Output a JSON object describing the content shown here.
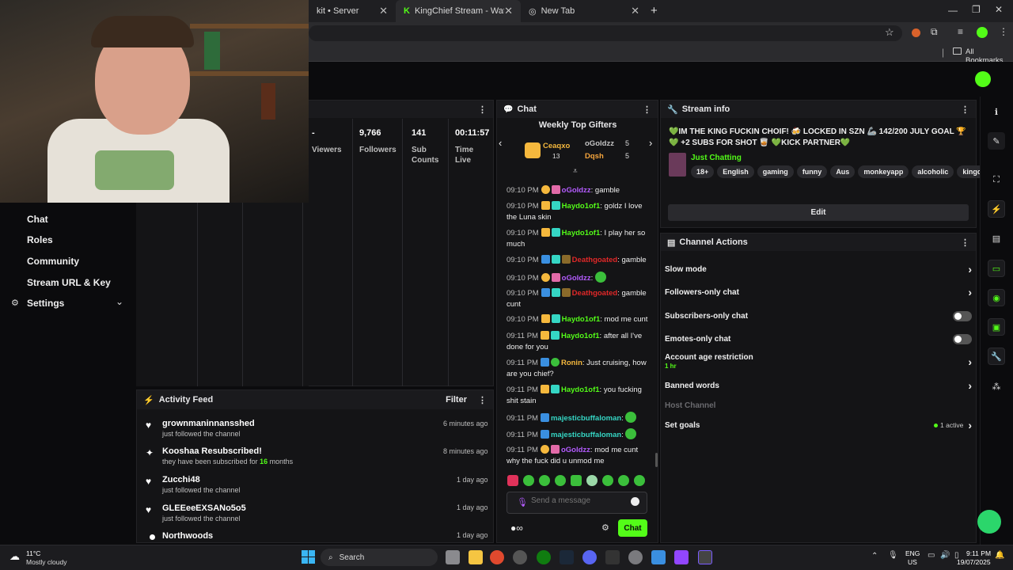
{
  "browser": {
    "tabs": [
      {
        "label": "kit • Server"
      },
      {
        "label": "KingChief Stream - Watch Live o"
      },
      {
        "label": "New Tab"
      }
    ],
    "new_tab": "+",
    "bookmarks_label": "All Bookmarks"
  },
  "nav": {
    "items": [
      {
        "label": "Chat"
      },
      {
        "label": "Roles"
      },
      {
        "label": "Community"
      },
      {
        "label": "Stream URL & Key"
      },
      {
        "label": "Settings"
      }
    ]
  },
  "stats": {
    "items": [
      {
        "value": "-",
        "label": "Viewers"
      },
      {
        "value": "9,766",
        "label": "Followers"
      },
      {
        "value": "141",
        "label": "Sub Counts"
      },
      {
        "value": "00:11:57",
        "label": "Time Live"
      }
    ]
  },
  "activity": {
    "title": "Activity Feed",
    "filter": "Filter",
    "items": [
      {
        "name": "grownmaninnansshed",
        "sub": "just followed the channel",
        "time": "6 minutes ago",
        "icon": "heart-icon"
      },
      {
        "name": "Kooshaa Resubscribed!",
        "sub_pre": "they have been subscribed for ",
        "sub_num": "16",
        "sub_post": " months",
        "time": "8 minutes ago",
        "icon": "sparkle-icon"
      },
      {
        "name": "Zucchi48",
        "sub": "just followed the channel",
        "time": "1 day ago",
        "icon": "heart-icon"
      },
      {
        "name": "GLEEeeEXSANo5o5",
        "sub": "just followed the channel",
        "time": "1 day ago",
        "icon": "heart-icon"
      },
      {
        "name": "Northwoods",
        "sub": "",
        "time": "1 day ago",
        "icon": "dot-icon"
      }
    ]
  },
  "chat": {
    "title": "Chat",
    "gifters_title": "Weekly Top Gifters",
    "gifters": [
      {
        "name": "Ceaqxo",
        "count": "13"
      },
      {
        "name": "oGoldzz",
        "count": "5"
      },
      {
        "name": "Dqsh",
        "count": "5"
      }
    ],
    "messages": [
      {
        "time": "09:10 PM",
        "user": "oGoldzz",
        "color": "#b45cff",
        "text": "gamble"
      },
      {
        "time": "09:10 PM",
        "user": "Haydo1of1",
        "color": "#53fc18",
        "text": "goldz I love the Luna skin"
      },
      {
        "time": "09:10 PM",
        "user": "Haydo1of1",
        "color": "#53fc18",
        "text": "I play her so much"
      },
      {
        "time": "09:10 PM",
        "user": "Deathgoated",
        "color": "#e02828",
        "text": "gamble"
      },
      {
        "time": "09:10 PM",
        "user": "oGoldzz",
        "color": "#b45cff",
        "text": ""
      },
      {
        "time": "09:10 PM",
        "user": "Deathgoated",
        "color": "#e02828",
        "text": "gamble cunt"
      },
      {
        "time": "09:10 PM",
        "user": "Haydo1of1",
        "color": "#53fc18",
        "text": "mod me cunt"
      },
      {
        "time": "09:11 PM",
        "user": "Haydo1of1",
        "color": "#53fc18",
        "text": "after all I've done for you"
      },
      {
        "time": "09:11 PM",
        "user": "Ronin",
        "color": "#f5b83d",
        "text": "Just cruising, how are you chief?"
      },
      {
        "time": "09:11 PM",
        "user": "Haydo1of1",
        "color": "#53fc18",
        "text": "you fucking shit stain"
      },
      {
        "time": "09:11 PM",
        "user": "majesticbuffaloman",
        "color": "#35d6c4",
        "text": ""
      },
      {
        "time": "09:11 PM",
        "user": "majesticbuffaloman",
        "color": "#35d6c4",
        "text": ""
      },
      {
        "time": "09:11 PM",
        "user": "oGoldzz",
        "color": "#b45cff",
        "text": "mod me cunt why the fuck did u unmod me"
      }
    ],
    "placeholder": "Send a message",
    "send_label": "Chat"
  },
  "stream_info": {
    "title": "Stream info",
    "stream_title": "💚IM THE KING FUCKIN CHOIF! 🍻 LOCKED IN SZN 🦾 142/200 JULY GOAL 🏆 💚 +2 SUBS FOR SHOT 🥃 💚KICK PARTNER💚",
    "category": "Just Chatting",
    "tags": [
      "18+",
      "English",
      "gaming",
      "funny",
      "Aus",
      "monkeyapp",
      "alcoholic",
      "kingchief"
    ],
    "edit_label": "Edit"
  },
  "channel_actions": {
    "title": "Channel Actions",
    "items": [
      {
        "label": "Slow mode",
        "control": "chevron"
      },
      {
        "label": "Followers-only chat",
        "control": "chevron"
      },
      {
        "label": "Subscribers-only chat",
        "control": "toggle"
      },
      {
        "label": "Emotes-only chat",
        "control": "toggle"
      },
      {
        "label": "Account age restriction",
        "sub": "1 hr",
        "control": "chevron"
      },
      {
        "label": "Banned words",
        "control": "chevron"
      },
      {
        "label": "Host Channel",
        "control": "none"
      },
      {
        "label": "Set goals",
        "status": "1 active",
        "control": "chevron"
      }
    ]
  },
  "taskbar": {
    "weather_temp": "11°C",
    "weather_desc": "Mostly cloudy",
    "search": "Search",
    "lang": "ENG",
    "region": "US",
    "time": "9:11 PM",
    "date": "19/07/2025"
  },
  "colors": {
    "accent": "#53fc18",
    "panel_bg": "#141416"
  }
}
